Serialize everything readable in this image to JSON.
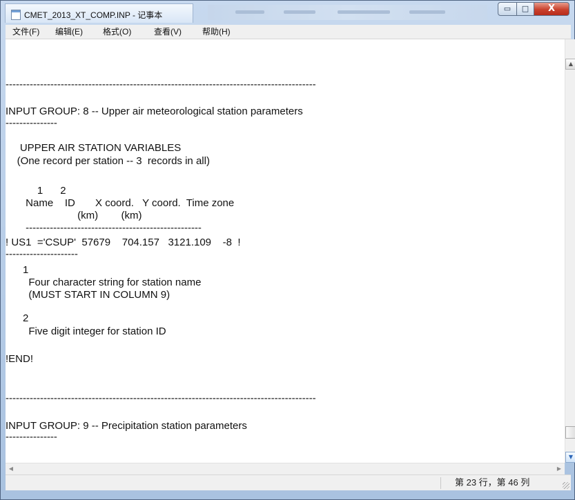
{
  "window": {
    "title": "CMET_2013_XT_COMP.INP - 记事本",
    "buttons": {
      "minimize": "▭",
      "maximize": "□",
      "close": "X"
    }
  },
  "menu": {
    "items": [
      "文件(F)",
      "编辑(E)",
      "格式(O)",
      "查看(V)",
      "帮助(H)"
    ]
  },
  "document": {
    "lines": [
      "",
      "",
      "------------------------------------------------------------------------------------------",
      "",
      "INPUT GROUP: 8 -- Upper air meteorological station parameters",
      "---------------",
      "",
      "     UPPER AIR STATION VARIABLES",
      "    (One record per station -- 3  records in all)",
      "",
      "           1      2",
      "       Name    ID       X coord.   Y coord.  Time zone",
      "                         (km)        (km)",
      "       ---------------------------------------------------",
      "! US1  ='CSUP'  57679    704.157   3121.109    -8  !",
      "---------------------",
      "",
      "      1",
      "        Four character string for station name",
      "        (MUST START IN COLUMN 9)",
      "",
      "      2",
      "        Five digit integer for station ID",
      "",
      "!END!",
      "",
      "",
      "------------------------------------------------------------------------------------------",
      "",
      "INPUT GROUP: 9 -- Precipitation station parameters",
      "---------------"
    ]
  },
  "scroll": {
    "up_arrow": "▲",
    "down_arrow": "▼",
    "left_arrow": "◀",
    "right_arrow": "▶"
  },
  "status": {
    "position": "第 23 行，第 46 列"
  }
}
